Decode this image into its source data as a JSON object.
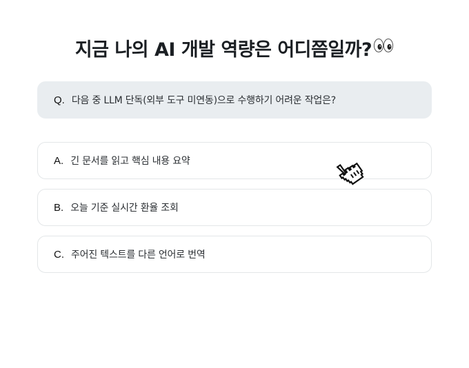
{
  "title": "지금 나의 AI 개발 역량은 어디쯤일까?",
  "title_emoji": "eyes-emoji",
  "question": {
    "marker": "Q.",
    "text": "다음 중 LLM 단독(외부 도구 미연동)으로 수행하기 어려운 작업은?"
  },
  "options": [
    {
      "marker": "A.",
      "text": "긴 문서를 읽고 핵심 내용 요약"
    },
    {
      "marker": "B.",
      "text": "오늘 기준 실시간 환율 조회"
    },
    {
      "marker": "C.",
      "text": "주어진 텍스트를 다른 언어로 번역"
    }
  ],
  "cursor_icon": "pointing-hand-cursor-icon",
  "colors": {
    "question_bg": "#e9edf0",
    "option_border": "#e3e6e8",
    "text": "#1f2328"
  }
}
